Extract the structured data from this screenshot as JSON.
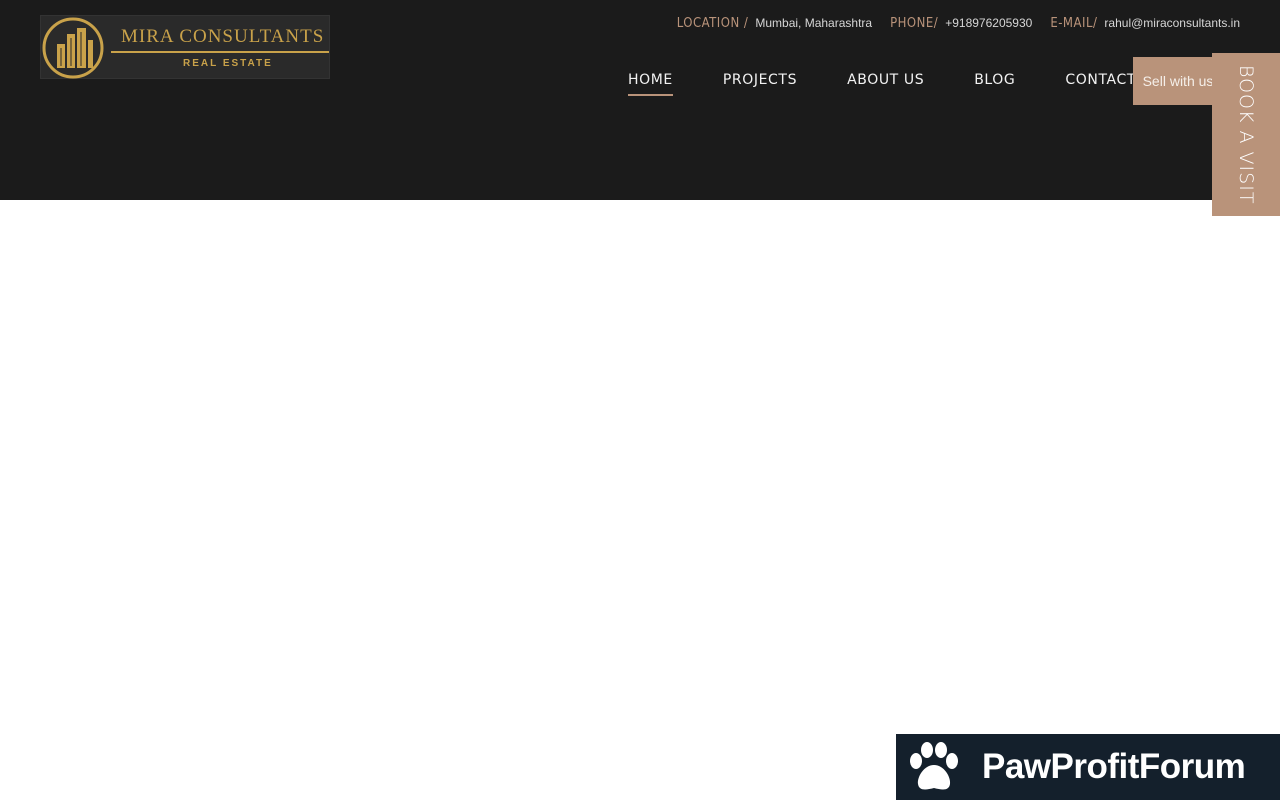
{
  "logo": {
    "name": "MIRA CONSULTANTS",
    "subtitle": "REAL ESTATE",
    "color": "#c9a24a"
  },
  "topbar": {
    "location_label": "LOCATION /",
    "location_value": "Mumbai, Maharashtra",
    "phone_label": "PHONE/",
    "phone_value": "+918976205930",
    "email_label": "E-MAIL/",
    "email_value": "rahul@miraconsultants.in"
  },
  "nav": {
    "items": [
      {
        "label": "HOME",
        "active": true
      },
      {
        "label": "PROJECTS"
      },
      {
        "label": "ABOUT US"
      },
      {
        "label": "BLOG"
      },
      {
        "label": "CONTACT"
      }
    ],
    "sell_button": "Sell with us"
  },
  "book_visit": "BOOK A VISIT",
  "badge": {
    "text": "PawProfitForum",
    "icon": "paw-icon"
  },
  "colors": {
    "header_bg": "#1b1b1b",
    "accent": "#b9937a",
    "badge_bg": "#14202c"
  }
}
